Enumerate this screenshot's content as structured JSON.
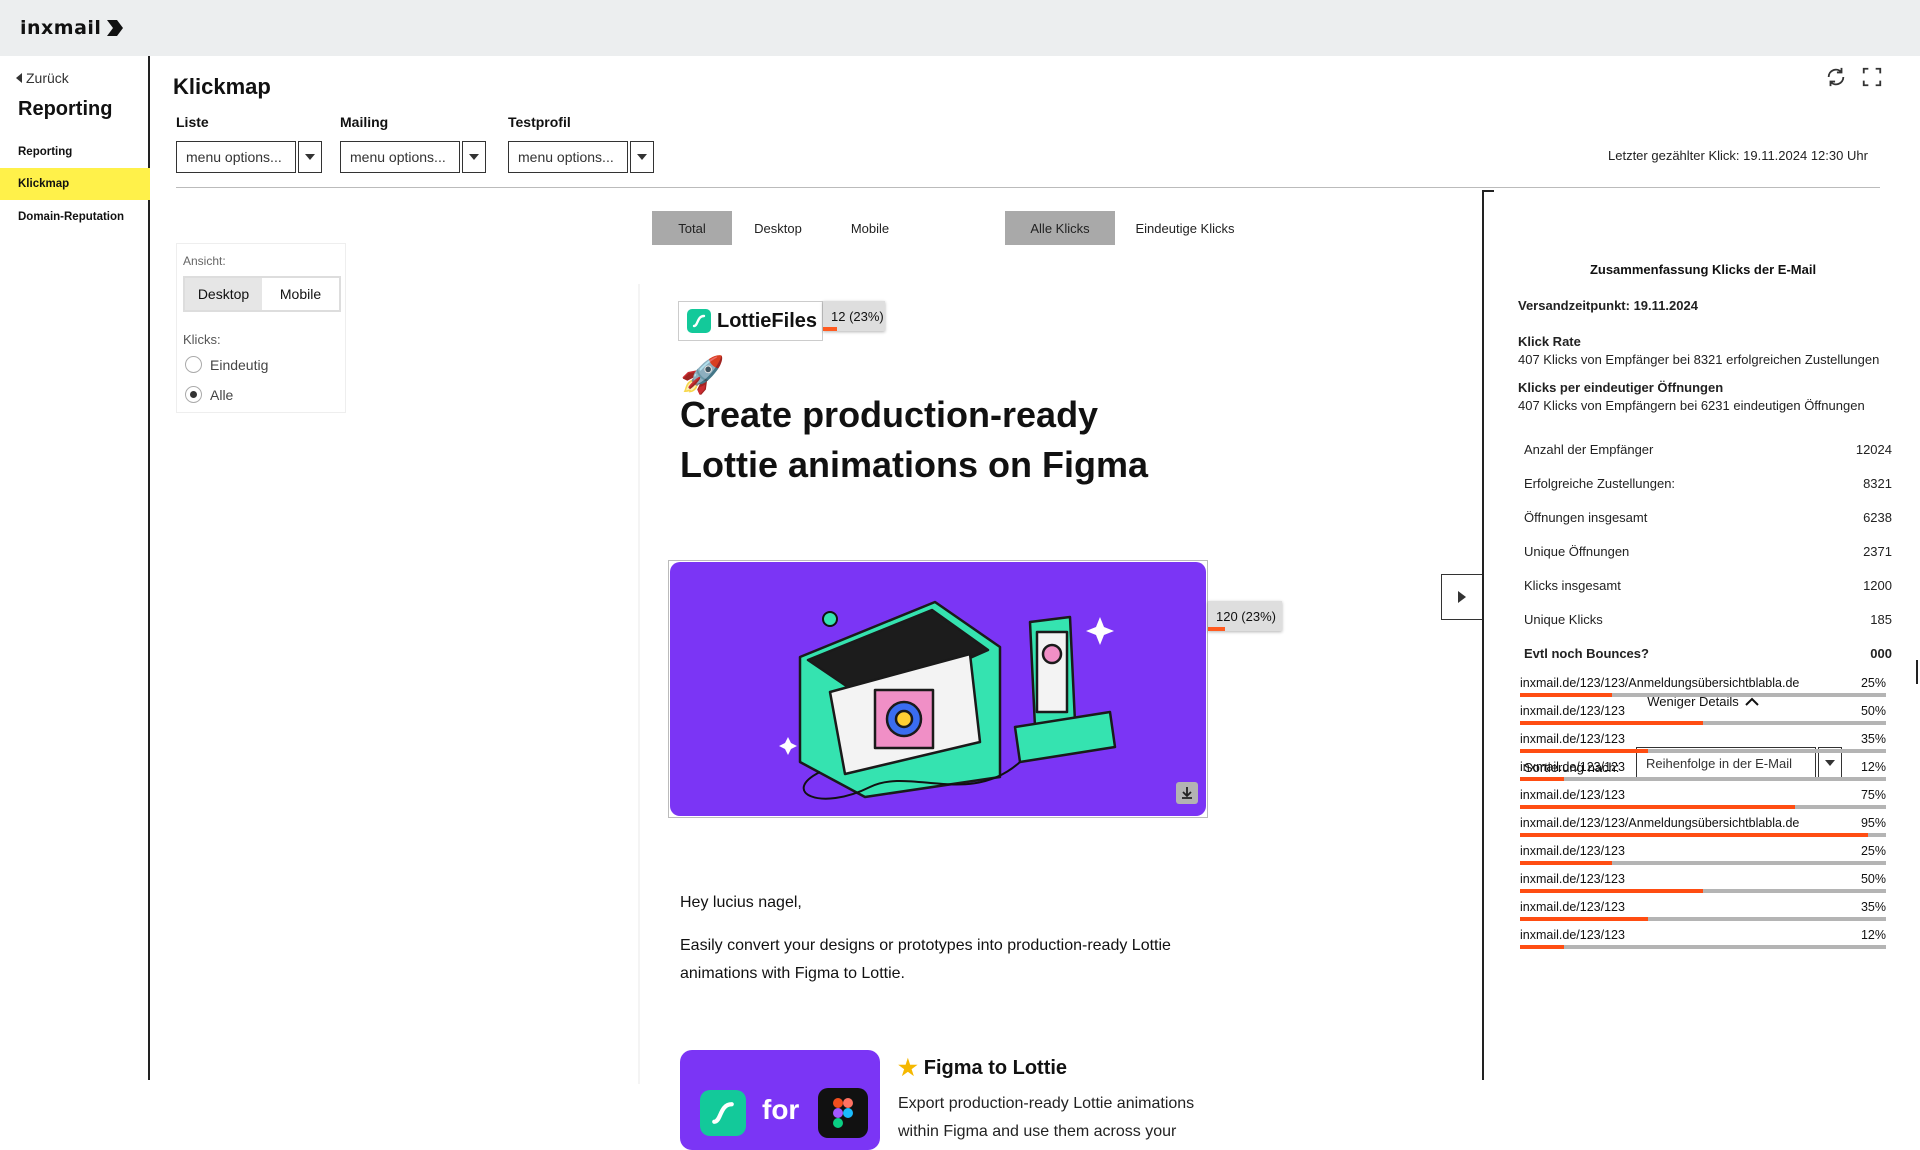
{
  "app": {
    "logo_text": "inxmail"
  },
  "sidebar": {
    "back_label": "Zurück",
    "title": "Reporting",
    "items": [
      {
        "label": "Reporting",
        "active": false
      },
      {
        "label": "Klickmap",
        "active": true
      },
      {
        "label": "Domain-Reputation",
        "active": false
      }
    ]
  },
  "header": {
    "title": "Klickmap",
    "last_click": "Letzter gezählter Klick: 19.11.2024 12:30 Uhr"
  },
  "filters": {
    "liste": {
      "label": "Liste",
      "value": "menu options..."
    },
    "mailing": {
      "label": "Mailing",
      "value": "menu options..."
    },
    "testprofil": {
      "label": "Testprofil",
      "value": "menu options..."
    }
  },
  "device_tabs": [
    {
      "label": "Total",
      "active": true
    },
    {
      "label": "Desktop",
      "active": false
    },
    {
      "label": "Mobile",
      "active": false
    }
  ],
  "click_tabs": [
    {
      "label": "Alle Klicks",
      "active": true
    },
    {
      "label": "Eindeutige Klicks",
      "active": false
    }
  ],
  "view_panel": {
    "ansicht_label": "Ansicht:",
    "desktop_label": "Desktop",
    "mobile_label": "Mobile",
    "klicks_label": "Klicks:",
    "eindeutig_label": "Eindeutig",
    "alle_label": "Alle",
    "selected": "Alle"
  },
  "email": {
    "logo_text": "LottieFiles",
    "logo_badge": {
      "label": "12 (23%)",
      "fraction": 0.23
    },
    "headline_line1": "Create production-ready",
    "headline_line2": "Lottie animations on Figma",
    "hero_badge": {
      "label": "120 (23%)",
      "fraction": 0.23
    },
    "greeting": "Hey lucius nagel,",
    "paragraph": "Easily convert your designs or prototypes into production-ready Lottie animations with Figma to Lottie.",
    "promo_title": "Figma to Lottie",
    "promo_for": "for",
    "promo_text": "Export production-ready Lottie animations within Figma and use them across your"
  },
  "summary": {
    "title": "Zusammenfassung  Klicks der E-Mail",
    "send_date": "Versandzeitpunkt: 19.11.2024",
    "click_rate_label": "Klick Rate",
    "click_rate_text": "407 Klicks von Empfänger bei  8321 erfolgreichen Zustellungen",
    "per_open_label": "Klicks per eindeutiger Öffnungen",
    "per_open_text": "407 Klicks von Empfängern bei 6231 eindeutigen Öffnungen",
    "stats": [
      {
        "label": "Anzahl der Empfänger",
        "value": "12024",
        "bold": false
      },
      {
        "label": "Erfolgreiche Zustellungen:",
        "value": "8321",
        "bold": false
      },
      {
        "label": "Öffnungen insgesamt",
        "value": "6238",
        "bold": false
      },
      {
        "label": "Unique Öffnungen",
        "value": "2371",
        "bold": false
      },
      {
        "label": "Klicks insgesamt",
        "value": "1200",
        "bold": false
      },
      {
        "label": "Unique Klicks",
        "value": "185",
        "bold": false
      },
      {
        "label": "Evtl noch Bounces?",
        "value": "000",
        "bold": true
      }
    ],
    "less_details": "Weniger Details",
    "sort_label": "Sortierung nach:",
    "sort_value": "Reihenfolge in der E-Mail",
    "links": [
      {
        "url": "inxmail.de/123/123/Anmeldungsübersichtblabla.de",
        "pct": "25%",
        "fraction": 0.25
      },
      {
        "url": "inxmail.de/123/123",
        "pct": "50%",
        "fraction": 0.5
      },
      {
        "url": "inxmail.de/123/123",
        "pct": "35%",
        "fraction": 0.35
      },
      {
        "url": "inxmail.de/123/123",
        "pct": "12%",
        "fraction": 0.12
      },
      {
        "url": "inxmail.de/123/123",
        "pct": "75%",
        "fraction": 0.75
      },
      {
        "url": "inxmail.de/123/123/Anmeldungsübersichtblabla.de",
        "pct": "95%",
        "fraction": 0.95
      },
      {
        "url": "inxmail.de/123/123",
        "pct": "25%",
        "fraction": 0.25
      },
      {
        "url": "inxmail.de/123/123",
        "pct": "50%",
        "fraction": 0.5
      },
      {
        "url": "inxmail.de/123/123",
        "pct": "35%",
        "fraction": 0.35
      },
      {
        "url": "inxmail.de/123/123",
        "pct": "12%",
        "fraction": 0.12
      }
    ]
  },
  "colors": {
    "highlight": "#fff14a",
    "progress": "#ff4d12",
    "hero_bg": "#7b35f5",
    "lottie_green": "#13c99a"
  },
  "icons": [
    "refresh-icon",
    "fullscreen-icon",
    "chevron-down-icon",
    "chevron-left-icon",
    "chevron-right-icon",
    "chevron-up-icon",
    "download-icon",
    "rocket-icon",
    "star-icon"
  ]
}
